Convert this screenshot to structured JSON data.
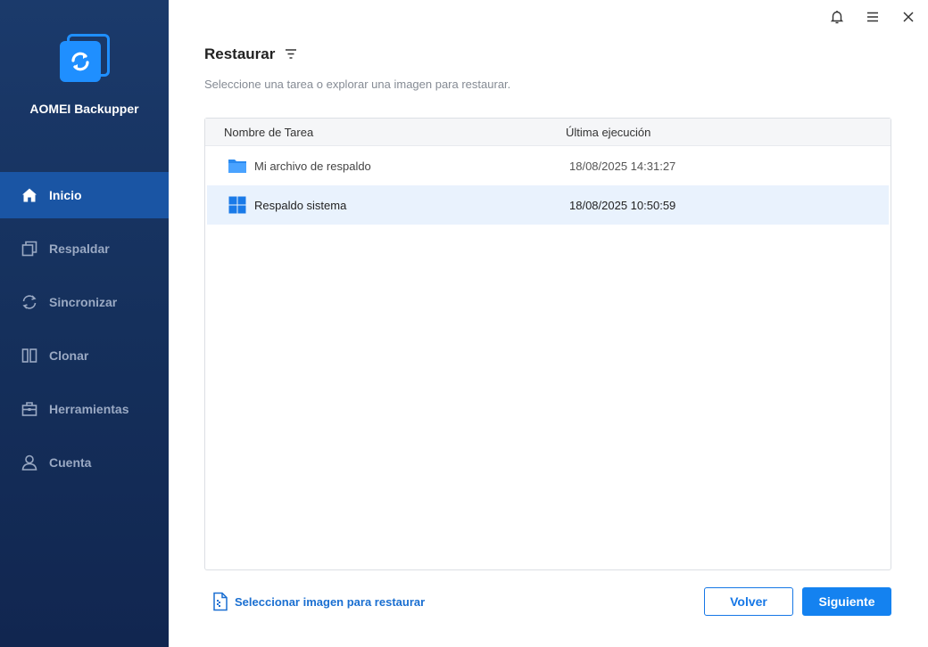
{
  "app": {
    "name": "AOMEI Backupper"
  },
  "sidebar": {
    "items": [
      {
        "label": "Inicio",
        "icon": "home-icon",
        "active": true
      },
      {
        "label": "Respaldar",
        "icon": "backup-icon",
        "active": false
      },
      {
        "label": "Sincronizar",
        "icon": "sync-icon",
        "active": false
      },
      {
        "label": "Clonar",
        "icon": "clone-icon",
        "active": false
      },
      {
        "label": "Herramientas",
        "icon": "toolbox-icon",
        "active": false
      },
      {
        "label": "Cuenta",
        "icon": "user-icon",
        "active": false
      }
    ]
  },
  "titlebar": {
    "icons": [
      "bell-icon",
      "menu-icon",
      "close-icon"
    ]
  },
  "main": {
    "title": "Restaurar",
    "subtitle": "Seleccione una tarea o explorar una imagen para restaurar.",
    "table": {
      "columns": [
        "Nombre de Tarea",
        "Última ejecución"
      ],
      "rows": [
        {
          "name": "Mi archivo de respaldo",
          "last_run": "18/08/2025 14:31:27",
          "icon": "folder-icon",
          "selected": false
        },
        {
          "name": "Respaldo sistema",
          "last_run": "18/08/2025 10:50:59",
          "icon": "windows-icon",
          "selected": true
        }
      ]
    },
    "select_image_link": "Seleccionar imagen para restaurar",
    "back_button": "Volver",
    "next_button": "Siguiente"
  },
  "colors": {
    "sidebar_bg": "#15305c",
    "active_nav": "#1a55a4",
    "accent": "#1482f0",
    "link": "#1a6fd1",
    "selected_row": "#e9f2fd"
  }
}
